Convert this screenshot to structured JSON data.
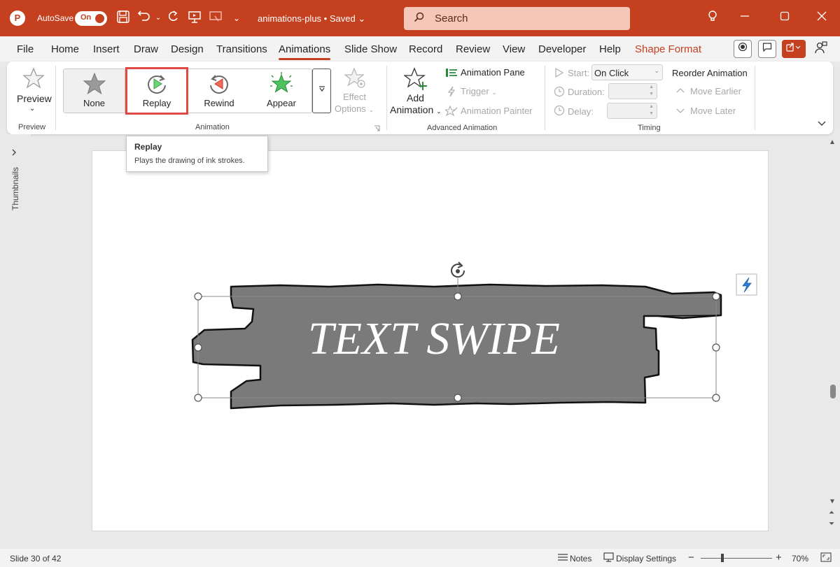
{
  "titlebar": {
    "app_letter": "P",
    "autosave_label": "AutoSave",
    "autosave_state": "On",
    "doc_title": "animations-plus • Saved",
    "search_placeholder": "Search"
  },
  "menu": {
    "tabs": [
      "File",
      "Home",
      "Insert",
      "Draw",
      "Design",
      "Transitions",
      "Animations",
      "Slide Show",
      "Record",
      "Review",
      "View",
      "Developer",
      "Help",
      "Shape Format"
    ],
    "active": "Animations"
  },
  "ribbon": {
    "preview_label": "Preview",
    "preview_group": "Preview",
    "gallery": [
      "None",
      "Replay",
      "Rewind",
      "Appear"
    ],
    "effect_options_1": "Effect",
    "effect_options_2": "Options",
    "animation_group": "Animation",
    "add_animation_1": "Add",
    "add_animation_2": "Animation",
    "animation_pane": "Animation Pane",
    "trigger": "Trigger",
    "animation_painter": "Animation Painter",
    "advanced_group": "Advanced Animation",
    "start_label": "Start:",
    "start_value": "On Click",
    "duration_label": "Duration:",
    "delay_label": "Delay:",
    "timing_group": "Timing",
    "reorder_label": "Reorder Animation",
    "move_earlier": "Move Earlier",
    "move_later": "Move Later"
  },
  "tooltip": {
    "title": "Replay",
    "description": "Plays the drawing of ink strokes."
  },
  "left_rail": {
    "thumbnails_label": "Thumbnails"
  },
  "slide": {
    "shape_text": "TEXT SWIPE"
  },
  "status": {
    "slide_info": "Slide 30 of 42",
    "notes": "Notes",
    "display_settings": "Display Settings",
    "zoom_minus": "−",
    "zoom_plus": "+",
    "zoom": "70%",
    "zoom_fraction": 0.3
  },
  "colors": {
    "accent": "#c4401f",
    "highlight": "#e04a43",
    "shape_fill": "#7a7a7a"
  },
  "icons": {
    "undo": "undo-icon",
    "redo": "redo-icon",
    "save": "save-icon",
    "lightbulb": "lightbulb-icon"
  }
}
